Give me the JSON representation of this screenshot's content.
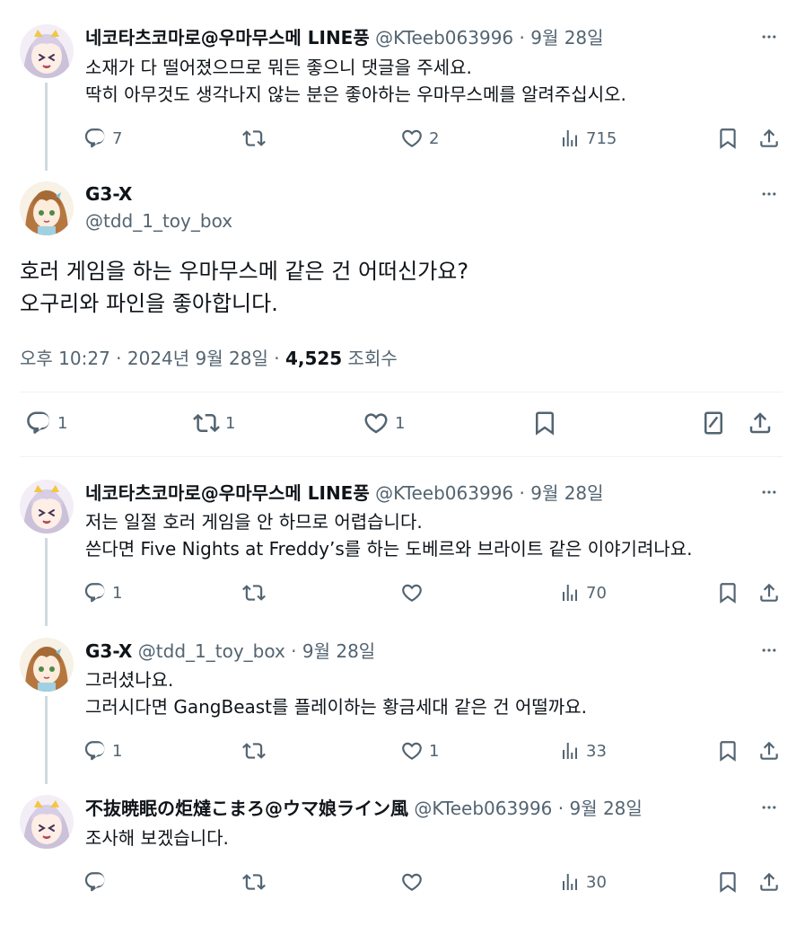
{
  "tweet1": {
    "name": "네코타츠코마로@우마무스메 LINE풍",
    "meta": "@KTeeb063996 · 9월 28일",
    "lines": [
      "소재가 다 떨어졌으므로 뭐든 좋으니 댓글을 주세요.",
      "딱히 아무것도 생각나지 않는 분은 좋아하는 우마무스메를 알려주십시오."
    ],
    "replies": "7",
    "retweets": "",
    "likes": "2",
    "views": "715"
  },
  "main": {
    "name": "G3-X",
    "handle": "@tdd_1_toy_box",
    "lines": [
      "호러 게임을 하는 우마무스메 같은 건 어떠신가요?",
      "오구리와 파인을 좋아합니다."
    ],
    "time": "오후 10:27 · 2024년 9월 28일 · ",
    "views_count": "4,525",
    "views_label": " 조회수",
    "replies": "1",
    "retweets": "1",
    "likes": "1"
  },
  "tweet3": {
    "name": "네코타츠코마로@우마무스메 LINE풍",
    "meta": "@KTeeb063996 · 9월 28일",
    "lines": [
      "저는 일절 호러 게임을 안 하므로 어렵습니다.",
      "쓴다면 Five Nights at Freddy’s를 하는 도베르와 브라이트 같은 이야기려나요."
    ],
    "replies": "1",
    "retweets": "",
    "likes": "",
    "views": "70"
  },
  "tweet4": {
    "name": "G3-X",
    "meta": "@tdd_1_toy_box · 9월 28일",
    "lines": [
      "그러셨나요.",
      "그러시다면 GangBeast를 플레이하는 황금세대 같은 건 어떨까요."
    ],
    "replies": "1",
    "retweets": "",
    "likes": "1",
    "views": "33"
  },
  "tweet5": {
    "name": "不抜暁眠の炬燵こまろ@ウマ娘ライン風",
    "meta": "@KTeeb063996 · 9월 28일",
    "lines": [
      "조사해 보겠습니다."
    ],
    "replies": "",
    "retweets": "",
    "likes": "",
    "views": "30"
  }
}
